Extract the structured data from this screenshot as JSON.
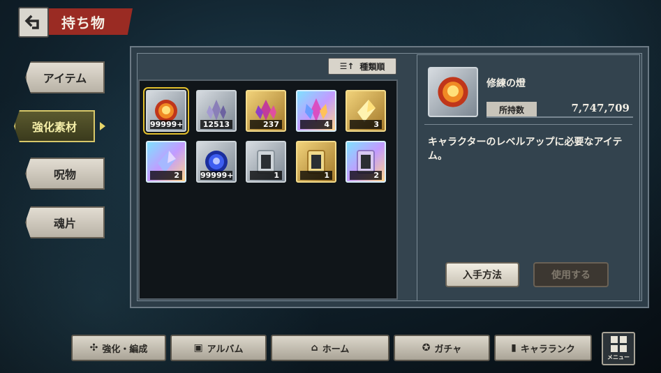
{
  "header": {
    "title": "持ち物"
  },
  "side_tabs": [
    {
      "label": "アイテム"
    },
    {
      "label": "強化素材"
    },
    {
      "label": "呪物"
    },
    {
      "label": "魂片"
    }
  ],
  "sort": {
    "label": "種類順",
    "icon": "sort-icon"
  },
  "items": [
    {
      "qty": "99999+",
      "rarity": "silver",
      "icon": "fire-orb-icon"
    },
    {
      "qty": "12513",
      "rarity": "silver",
      "icon": "crystal-cluster-icon"
    },
    {
      "qty": "237",
      "rarity": "gold",
      "icon": "crystal-cluster-icon"
    },
    {
      "qty": "4",
      "rarity": "rainbow",
      "icon": "crystal-cluster-icon"
    },
    {
      "qty": "3",
      "rarity": "gold",
      "icon": "crystal-shard-icon"
    },
    {
      "qty": "2",
      "rarity": "rainbow",
      "icon": "crystal-shard-icon"
    },
    {
      "qty": "99999+",
      "rarity": "silver",
      "icon": "blue-orb-icon"
    },
    {
      "qty": "1",
      "rarity": "silver",
      "icon": "mirror-icon"
    },
    {
      "qty": "1",
      "rarity": "gold",
      "icon": "mirror-icon"
    },
    {
      "qty": "2",
      "rarity": "rainbow",
      "icon": "mirror-icon"
    }
  ],
  "detail": {
    "name": "修練の燈",
    "owned_label": "所持数",
    "owned_value": "7,747,709",
    "description": "キャラクターのレベルアップに必要なアイテム。",
    "obtain_label": "入手方法",
    "use_label": "使用する"
  },
  "nav": {
    "enhance": "強化・編成",
    "album": "アルバム",
    "home": "ホーム",
    "gacha": "ガチャ",
    "rank": "キャラランク",
    "menu": "メニュー"
  },
  "colors": {
    "accent_red": "#9a2b23",
    "active_tab_gold": "#d8c86a",
    "selected_outline": "#e3c02d"
  }
}
